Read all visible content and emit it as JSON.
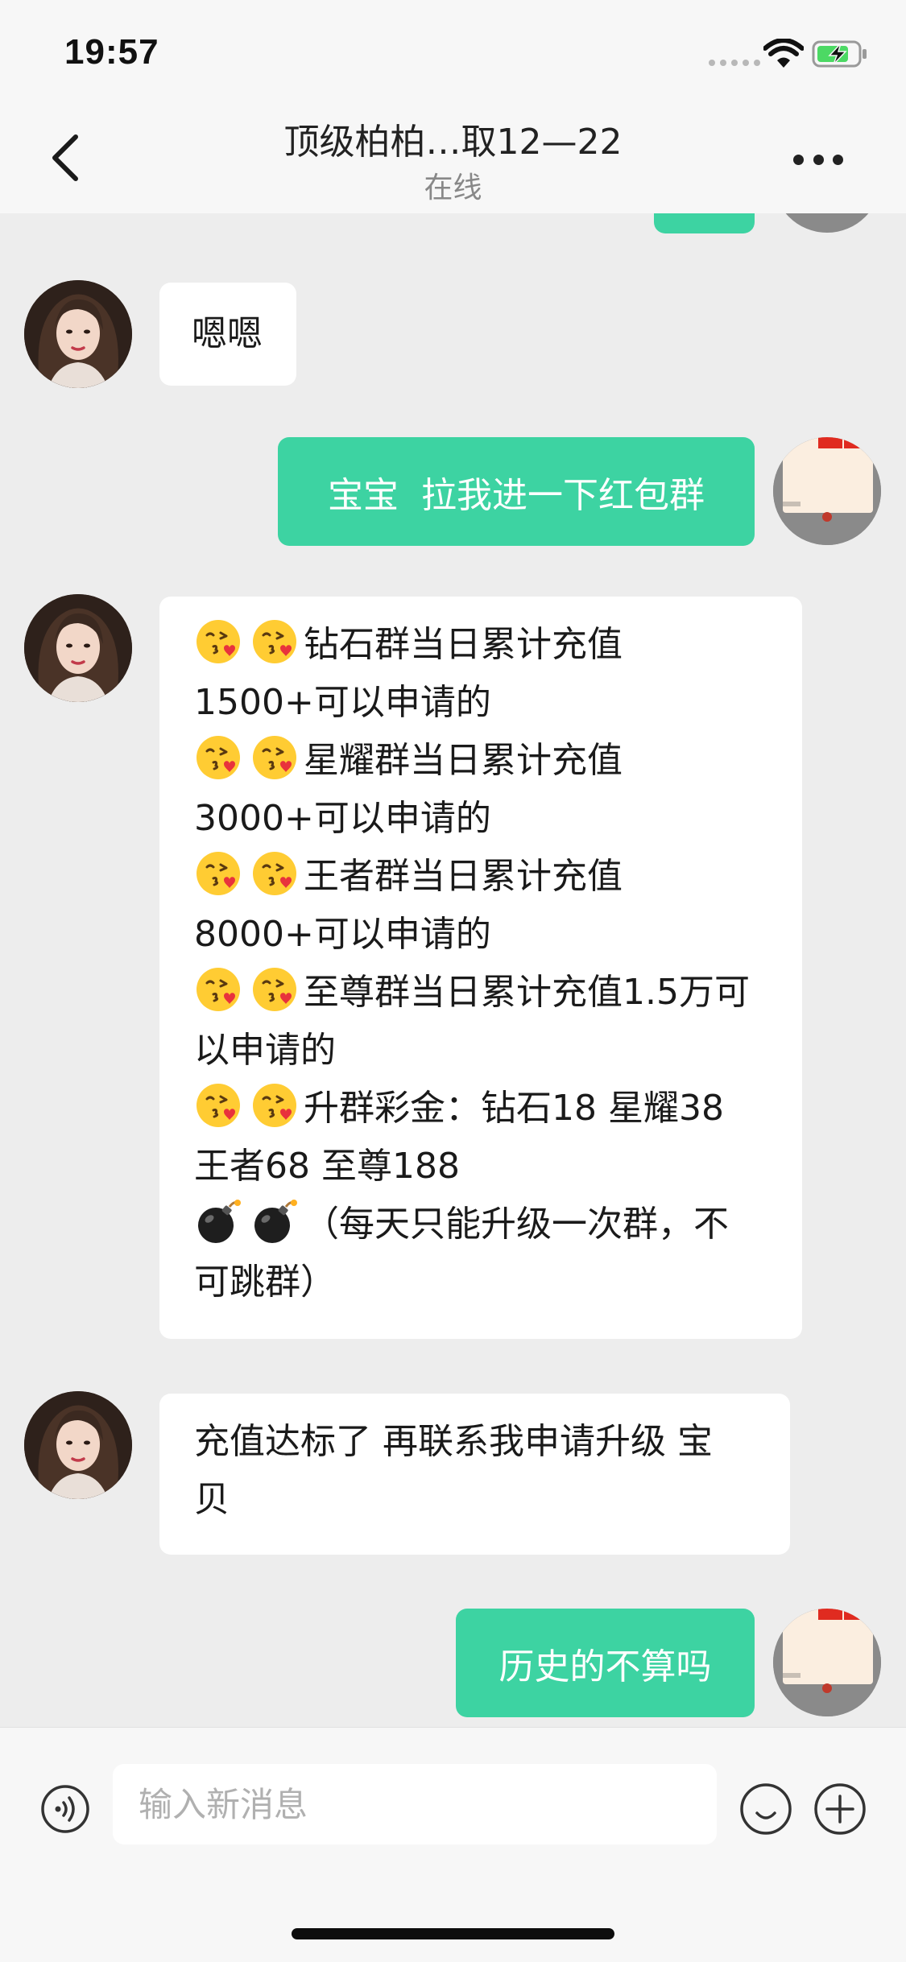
{
  "status_bar": {
    "time": "19:57"
  },
  "header": {
    "title": "顶级柏柏…取12—22",
    "subtitle": "在线"
  },
  "messages": [
    {
      "side": "left",
      "text": "嗯嗯"
    },
    {
      "side": "right",
      "text": "宝宝  拉我进一下红包群"
    },
    {
      "side": "left",
      "lines": [
        {
          "emoji": "kissing-heart",
          "text": "钻石群当日累计充值"
        },
        {
          "text": "1500+可以申请的"
        },
        {
          "emoji": "kissing-heart",
          "text": "星耀群当日累计充值"
        },
        {
          "text": "3000+可以申请的"
        },
        {
          "emoji": "kissing-heart",
          "text": "王者群当日累计充值"
        },
        {
          "text": "8000+可以申请的"
        },
        {
          "emoji": "kissing-heart",
          "text": "至尊群当日累计充值1.5万可"
        },
        {
          "text": "以申请的"
        },
        {
          "emoji": "kissing-heart",
          "text": "升群彩金：钻石18 星耀38"
        },
        {
          "text": "王者68 至尊188"
        },
        {
          "emoji": "bomb",
          "text": "（每天只能升级一次群，不"
        },
        {
          "text": "可跳群）"
        }
      ]
    },
    {
      "side": "left",
      "lines": [
        {
          "text": "充值达标了 再联系我申请升级 宝"
        },
        {
          "text": "贝"
        }
      ]
    },
    {
      "side": "right",
      "text": "历史的不算吗"
    }
  ],
  "input": {
    "placeholder": "输入新消息"
  },
  "colors": {
    "sent_bubble": "#3dd3a2",
    "received_bubble": "#ffffff",
    "chat_background": "#ededed"
  }
}
